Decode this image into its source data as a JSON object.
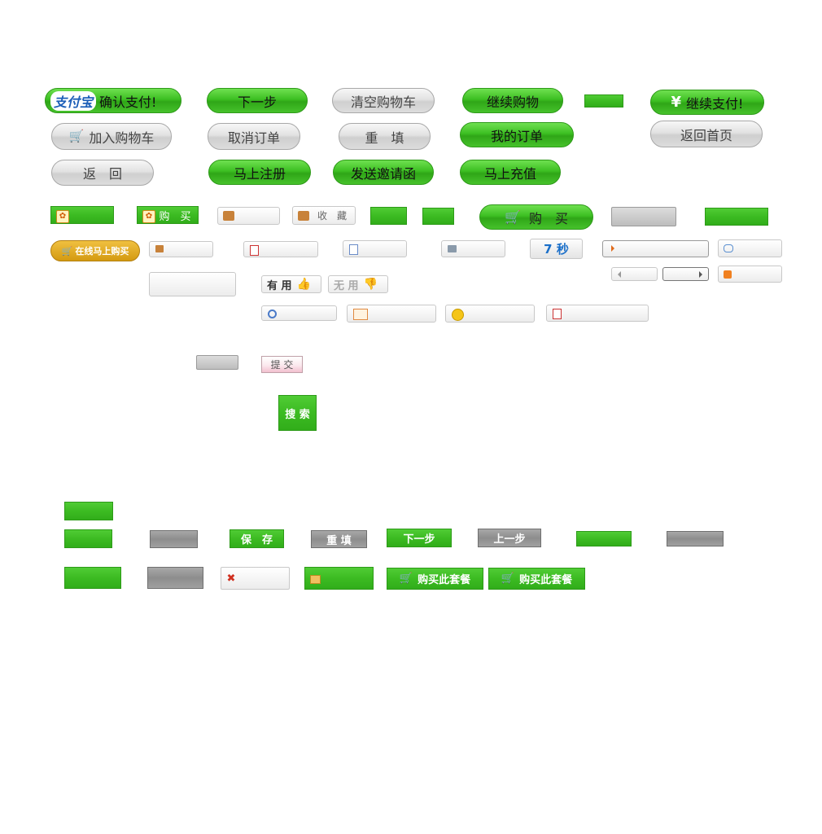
{
  "row1": {
    "alipay_logo": "支付宝",
    "confirm_pay": "确认支付!",
    "next_step": "下一步",
    "clear_cart": "清空购物车",
    "continue_shopping": "继续购物",
    "yuan_icon": "¥",
    "continue_pay": "继续支付!"
  },
  "row2": {
    "add_to_cart": "加入购物车",
    "cancel_order": "取消订单",
    "reset": "重　填",
    "my_orders": "我的订单",
    "back_home": "返回首页"
  },
  "row3": {
    "back": "返　回",
    "register_now": "马上注册",
    "send_invite": "发送邀请函",
    "recharge_now": "马上充值"
  },
  "row4": {
    "buy_small": "购　买",
    "favorite": "收　藏",
    "buy_big": "购　买"
  },
  "row5": {
    "buy_online_now": "在线马上购买",
    "countdown": "7 秒"
  },
  "row6": {
    "useful": "有 用",
    "useless": "无 用"
  },
  "row8": {
    "submit": "提 交"
  },
  "search_button": "搜 索",
  "row_bottom1": {
    "save": "保　存",
    "reset": "重 填",
    "next_step": "下一步",
    "prev_step": "上一步"
  },
  "row_bottom2": {
    "buy_package_1": "购买此套餐",
    "buy_package_2": "购买此套餐"
  },
  "colors": {
    "green": "#3cbb22",
    "gray": "#cfcfcf",
    "gold": "#d9a520",
    "countdown_blue": "#1a6fc9"
  }
}
